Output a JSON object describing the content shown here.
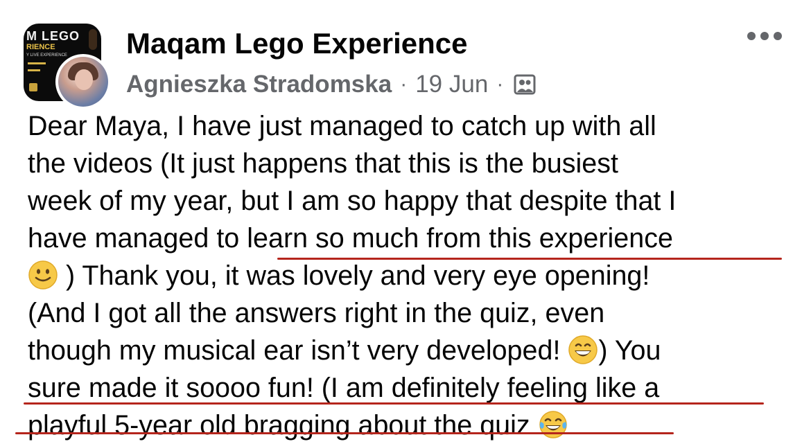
{
  "post": {
    "group_name": "Maqam Lego Experience",
    "author": "Agnieszka Stradomska",
    "separator": "·",
    "date": "19 Jun",
    "audience_icon": "members-group-icon",
    "more_icon": "more-options-icon",
    "group_avatar_text": {
      "line1": "M LEGO",
      "line2": "RIENCE",
      "line3": "Y LIVE EXPERIENCE"
    },
    "lines": [
      {
        "text": "Dear Maya, I have just managed to catch up with all"
      },
      {
        "text": "the videos (It just happens that this is the busiest"
      },
      {
        "text": "week of my year, but I am so happy that despite that I"
      },
      {
        "text": "have managed to learn so much from this experience"
      },
      {
        "before": "",
        "emoji": "slightly-smiling-face-emoji",
        "after": " ) Thank you, it was lovely and very eye opening!"
      },
      {
        "text": "(And I got all the answers right in the quiz, even"
      },
      {
        "before": "though my musical ear isn’t very developed! ",
        "emoji": "grinning-face-emoji",
        "after": ") You"
      },
      {
        "text": "sure made it soooo fun! (I am definitely feeling like a"
      },
      {
        "before": "playful 5-year old bragging about the quiz ",
        "emoji": "tears-of-joy-emoji",
        "after": ""
      }
    ],
    "annotation_color": "#b5251c",
    "text_color": "#050505",
    "meta_color": "#65676b"
  }
}
